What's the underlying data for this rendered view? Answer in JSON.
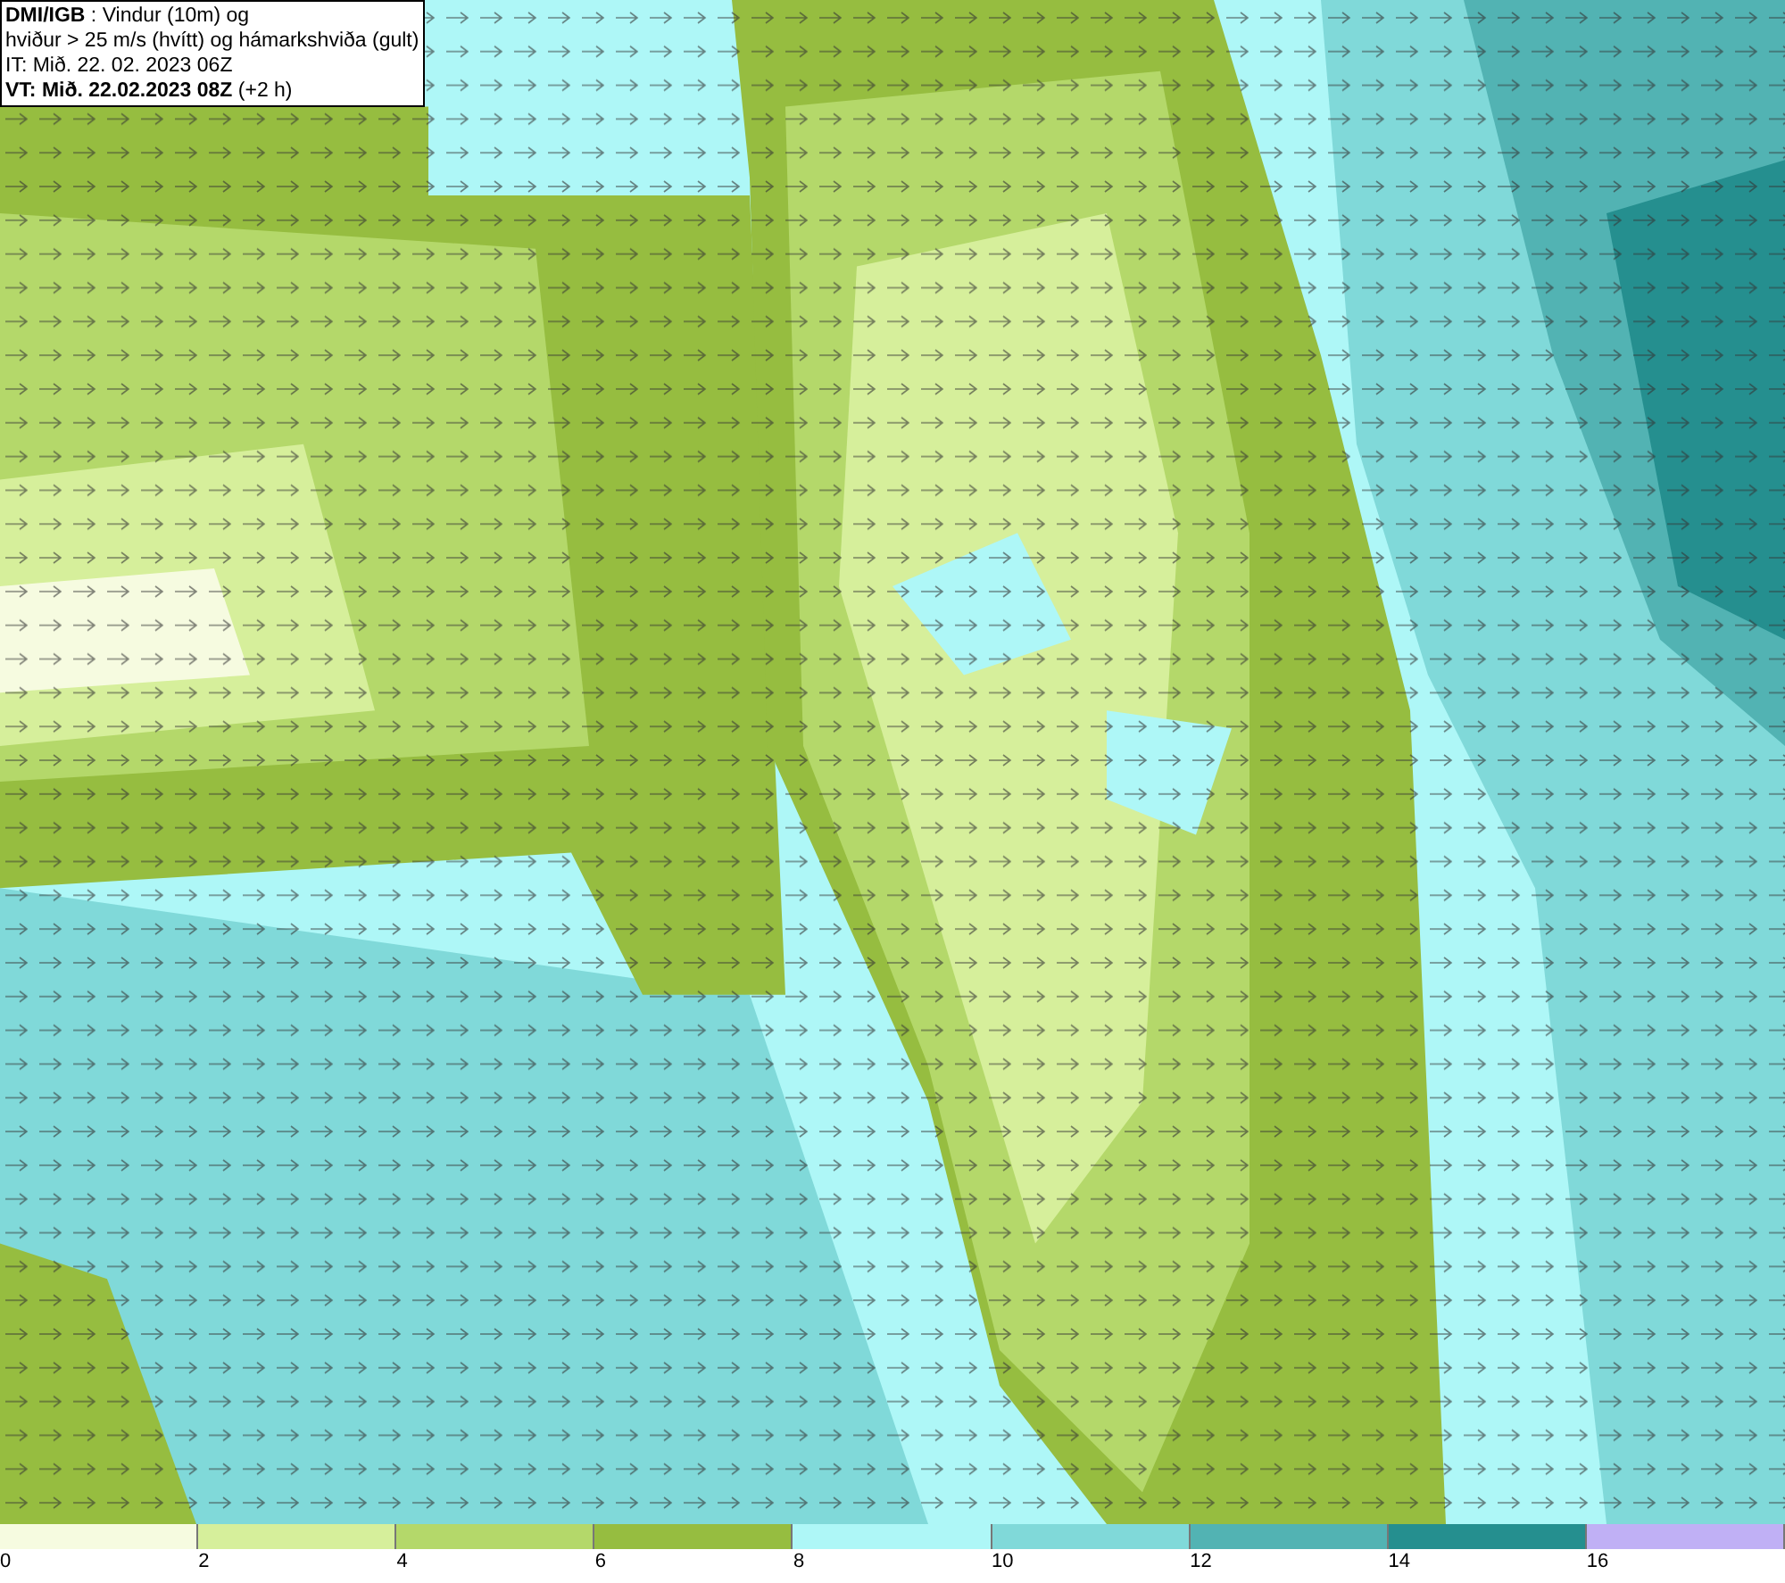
{
  "title_box": {
    "lines": [
      "**DMI/IGB** : Vindur (10m) og",
      "hviður > 25 m/s (hvítt) og hámarkshviða (gult)",
      "IT: Mið. 22. 02. 2023 06Z",
      "**VT: Mið. 22.02.2023 08Z** (+2 h)"
    ]
  },
  "legend": [
    {
      "label": "0",
      "color": "#f6fbe0"
    },
    {
      "label": "2",
      "color": "#d6ef9b"
    },
    {
      "label": "4",
      "color": "#b4d86a"
    },
    {
      "label": "6",
      "color": "#96bd40"
    },
    {
      "label": "8",
      "color": "#aef7f7"
    },
    {
      "label": "10",
      "color": "#80d9d9"
    },
    {
      "label": "12",
      "color": "#52b3b3"
    },
    {
      "label": "14",
      "color": "#258f8f"
    },
    {
      "label": "16",
      "color": "#c0b0f5"
    }
  ]
}
